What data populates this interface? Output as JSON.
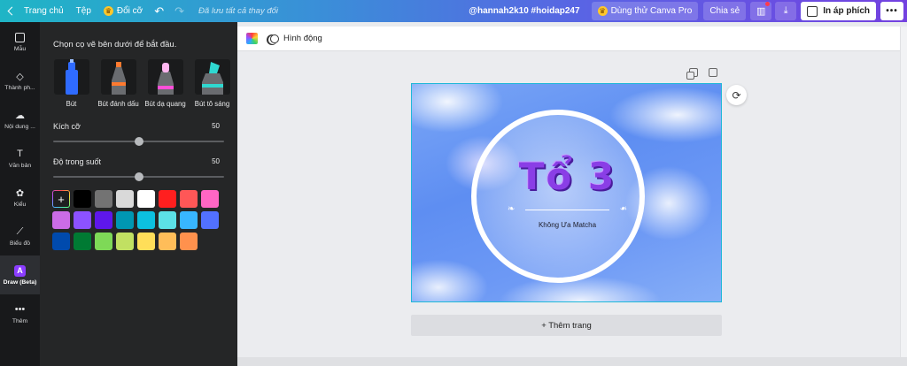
{
  "topbar": {
    "home": "Trang chủ",
    "file": "Tệp",
    "resize": "Đổi cỡ",
    "saved_status": "Đã lưu tất cả thay đổi",
    "doc_title": "@hannah2k10 #hoidap247",
    "try_pro": "Dùng thử Canva Pro",
    "share": "Chia sẻ",
    "print": "In áp phích",
    "more": "•••"
  },
  "rail": {
    "items": [
      {
        "label": "Mẫu",
        "icon": "template-icon"
      },
      {
        "label": "Thành ph...",
        "icon": "elements-icon"
      },
      {
        "label": "Nội dung ...",
        "icon": "upload-icon"
      },
      {
        "label": "Văn bản",
        "icon": "text-icon"
      },
      {
        "label": "Kiểu",
        "icon": "styles-icon"
      },
      {
        "label": "Biểu đồ",
        "icon": "chart-icon"
      },
      {
        "label": "Draw (Beta)",
        "icon": "draw-icon"
      },
      {
        "label": "Thêm",
        "icon": "more-icon"
      }
    ]
  },
  "panel": {
    "intro": "Chọn cọ vẽ bên dưới để bắt đầu.",
    "pens": [
      {
        "label": "Bút",
        "color": "#2f6bff"
      },
      {
        "label": "Bút đánh dấu",
        "color": "#ff7a2f"
      },
      {
        "label": "Bút dạ quang",
        "color": "#ff4fd8"
      },
      {
        "label": "Bút tô sáng",
        "color": "#2fd8d0"
      }
    ],
    "size_label": "Kích cỡ",
    "size_value": "50",
    "size_fraction": 0.5,
    "opacity_label": "Độ trong suốt",
    "opacity_value": "50",
    "opacity_fraction": 0.5,
    "add_color": "+",
    "swatches": [
      "#000000",
      "#737373",
      "#d9d9d9",
      "#ffffff",
      "#ff1f1f",
      "#ff5757",
      "#ff66c4",
      "#cb6ce6",
      "#8c52ff",
      "#5e17eb",
      "#0097b2",
      "#0cc0df",
      "#5ce1e6",
      "#38b6ff",
      "#5271ff",
      "#004aad",
      "#007a33",
      "#7ed957",
      "#c1e062",
      "#ffde59",
      "#ffbd59",
      "#ff914d"
    ]
  },
  "editor": {
    "animate": "Hình động",
    "add_page": "+ Thêm trang",
    "design": {
      "title": "Tổ 3",
      "subtitle": "Không Ưa Matcha"
    }
  }
}
